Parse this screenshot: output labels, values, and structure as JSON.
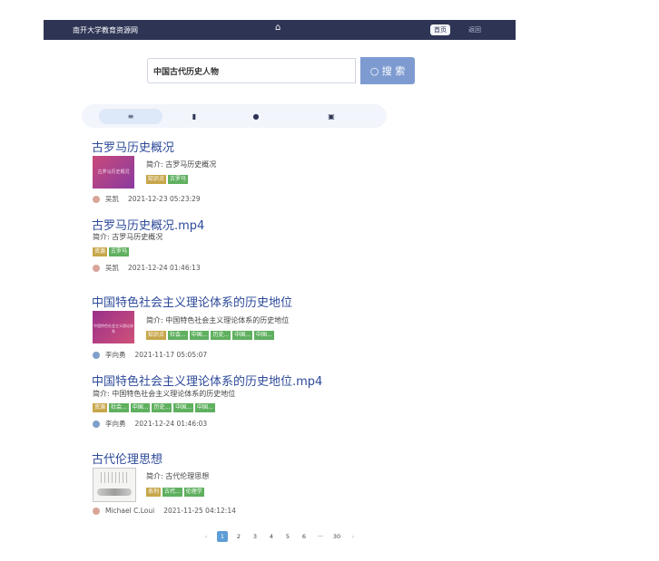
{
  "nav": {
    "title": "南开大学教育资源网",
    "home_label": "首页",
    "return_label": "返回"
  },
  "search": {
    "query": "中国古代历史人物",
    "button_label": "搜 索"
  },
  "tabs": [
    {
      "icon": "list-icon"
    },
    {
      "icon": "bookmark-icon"
    },
    {
      "icon": "user-icon"
    },
    {
      "icon": "book-icon"
    }
  ],
  "results": [
    {
      "title": "古罗马历史概况",
      "thumb_text": "古罗马历史概况",
      "summary": "简介: 古罗马历史概况",
      "tags": [
        "知识点",
        "古罗马"
      ],
      "author": "吴凯",
      "date": "2021-12-23 05:23:29"
    },
    {
      "title": "古罗马历史概况.mp4",
      "summary": "简介: 古罗马历史概况",
      "tags": [
        "资源",
        "古罗马"
      ],
      "author": "吴凯",
      "date": "2021-12-24 01:46:13"
    },
    {
      "title": "中国特色社会主义理论体系的历史地位",
      "thumb_text": "中国特色社会主义理论体系",
      "summary": "简介: 中国特色社会主义理论体系的历史地位",
      "tags": [
        "知识点",
        "社会...",
        "中国...",
        "历史...",
        "中国...",
        "中国..."
      ],
      "author": "李向勇",
      "date": "2021-11-17 05:05:07"
    },
    {
      "title": "中国特色社会主义理论体系的历史地位.mp4",
      "summary": "简介: 中国特色社会主义理论体系的历史地位",
      "tags": [
        "资源",
        "社会...",
        "中国...",
        "历史...",
        "中国...",
        "中国..."
      ],
      "author": "李向勇",
      "date": "2021-12-24 01:46:03"
    },
    {
      "title": "古代伦理思想",
      "summary": "简介: 古代伦理思想",
      "tags": [
        "系列",
        "古代...",
        "伦理学"
      ],
      "author": "Michael C.Loui",
      "date": "2021-11-25 04:12:14"
    }
  ],
  "pagination": {
    "prev": "‹",
    "pages": [
      "1",
      "2",
      "3",
      "4",
      "5",
      "6",
      "···",
      "30"
    ],
    "next": "›",
    "current": "1"
  },
  "colors": {
    "nav_bg": "#2e3454",
    "search_btn": "#7e9bd1",
    "title_link": "#2d4a9a",
    "tag_gold": "#c7a64a",
    "tag_green": "#5fb05f"
  }
}
